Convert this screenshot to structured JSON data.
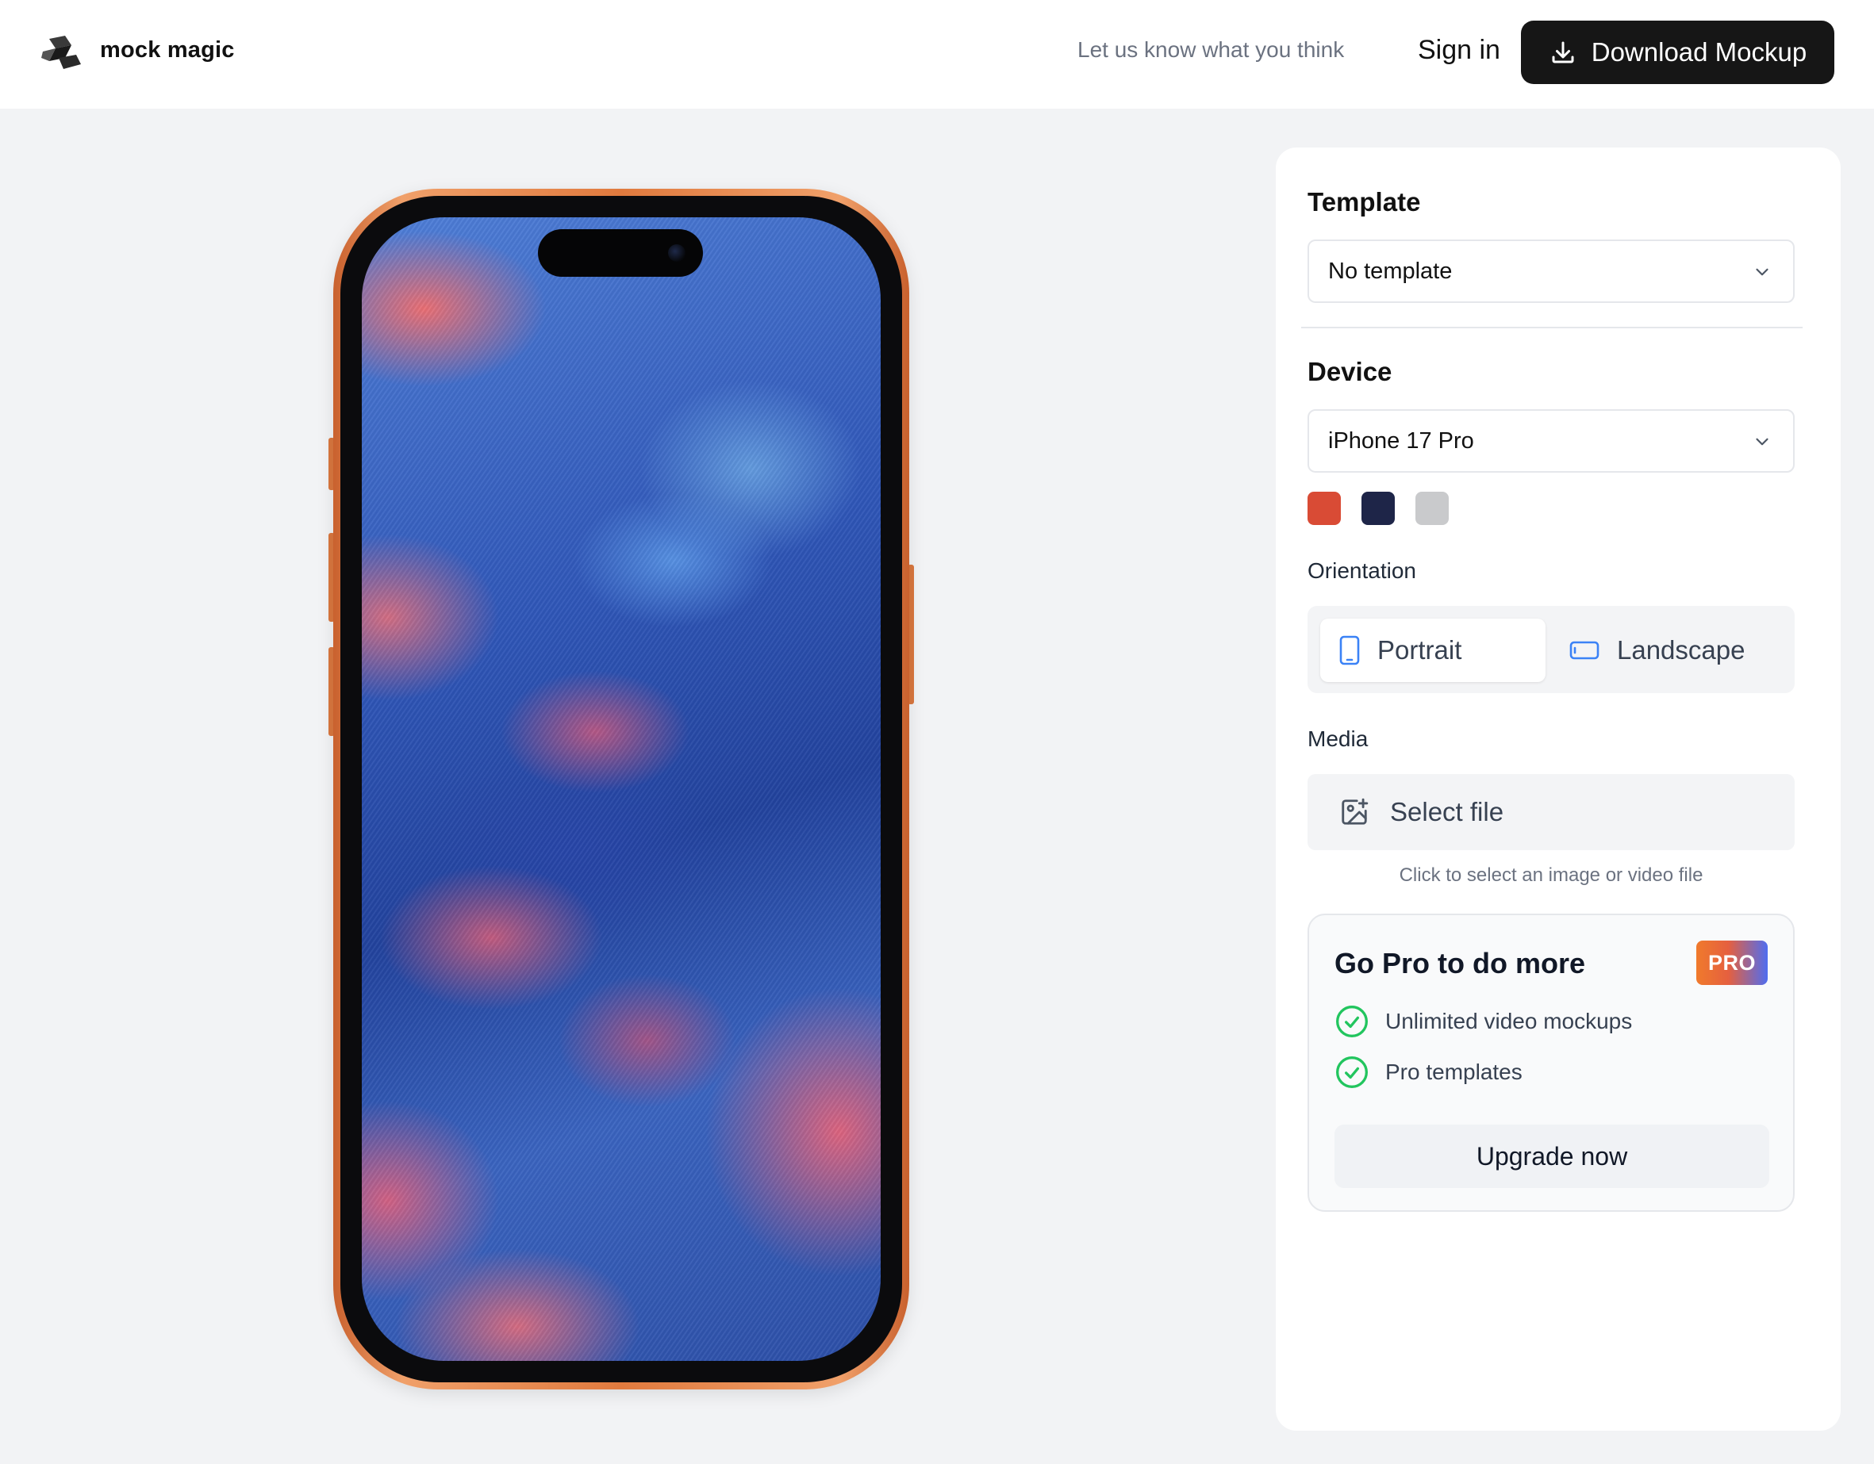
{
  "header": {
    "brand": "mock magic",
    "feedback": "Let us know what you think",
    "sign_in": "Sign in",
    "download_label": "Download Mockup"
  },
  "panel": {
    "template": {
      "title": "Template",
      "selected": "No template"
    },
    "device": {
      "title": "Device",
      "selected": "iPhone 17 Pro",
      "colors": [
        "#d94b35",
        "#1e2548",
        "#c9cacc"
      ]
    },
    "orientation": {
      "label": "Orientation",
      "options": [
        "Portrait",
        "Landscape"
      ],
      "selected": "Portrait"
    },
    "media": {
      "label": "Media",
      "button": "Select file",
      "hint": "Click to select an image or video file"
    },
    "pro": {
      "title": "Go Pro to do more",
      "badge": "PRO",
      "features": [
        "Unlimited video mockups",
        "Pro templates"
      ],
      "upgrade": "Upgrade now"
    }
  },
  "icons": {
    "download": "download-icon",
    "chevron": "chevron-down-icon",
    "portrait": "phone-portrait-icon",
    "landscape": "phone-landscape-icon",
    "media": "image-add-icon",
    "check": "check-circle-icon"
  },
  "colors": {
    "accent_dark": "#161616",
    "phone_frame": "#e07a3e",
    "check_green": "#22c55e",
    "portrait_blue": "#3b82f6"
  }
}
